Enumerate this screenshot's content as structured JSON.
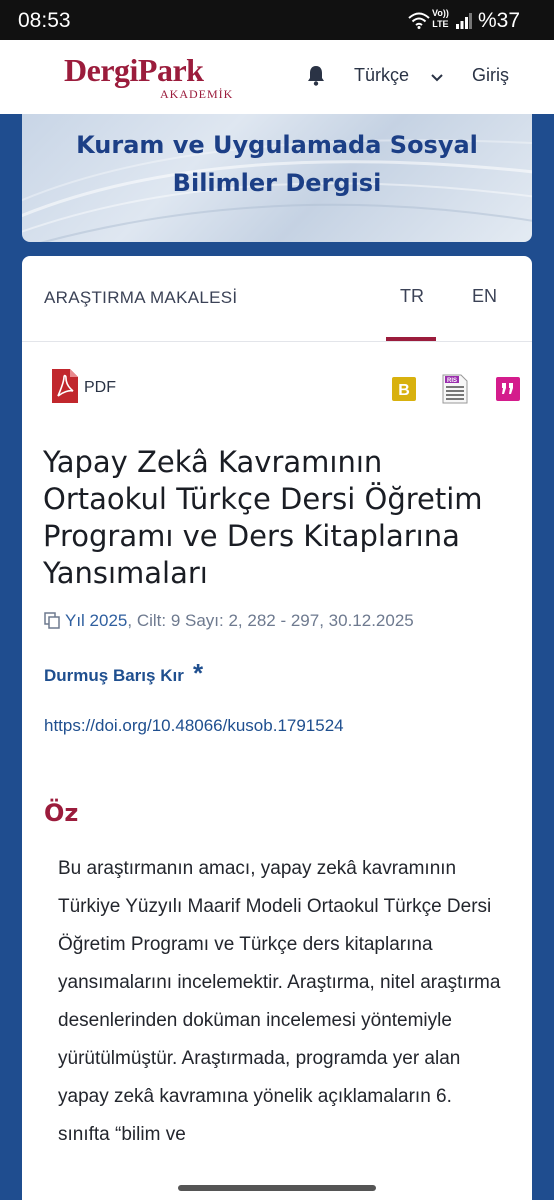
{
  "status_bar": {
    "time": "08:53",
    "volte_line1": "Vo))",
    "volte_line2": "LTE",
    "battery": "%37"
  },
  "nav": {
    "logo_main": "DergiPark",
    "logo_sub": "AKADEMİK",
    "language": "Türkçe",
    "login": "Giriş",
    "icons": [
      "bell-icon",
      "chevron-down-icon"
    ]
  },
  "journal": {
    "title_line1": "Kuram ve Uygulamada Sosyal",
    "title_line2": "Bilimler Dergisi"
  },
  "article": {
    "type": "ARAŞTIRMA MAKALESİ",
    "tabs": [
      "TR",
      "EN"
    ],
    "active_tab": "TR",
    "pdf_label": "PDF",
    "cite_b_letter": "B",
    "cite_ris_label": "RIS",
    "title": "Yapay Zekâ Kavramının Ortaokul Türkçe Dersi Öğretim Programı ve Ders Kitaplarına Yansımaları",
    "meta_year": "Yıl 2025",
    "meta_rest": ", Cilt: 9 Sayı: 2, 282 - 297, 30.12.2025",
    "author": "Durmuş Barış Kır",
    "author_mark": "*",
    "doi": "https://doi.org/10.48066/kusob.1791524"
  },
  "abstract": {
    "heading": "Öz",
    "text": "Bu araştırmanın amacı, yapay zekâ kavramının Türkiye Yüzyılı Maarif Modeli Ortaokul Türkçe Dersi Öğretim Programı ve Türkçe ders kitaplarına yansımalarını incelemektir. Araştırma, nitel araştırma desenlerinden doküman incelemesi yöntemiyle yürütülmüştür. Araştırmada, programda yer alan yapay zekâ kavramına yönelik açıklamaların 6. sınıfta “bilim ve"
  },
  "colors": {
    "brand": "#9b1c3c",
    "link": "#1f4f8f",
    "page_bg": "#1f4d8f"
  }
}
